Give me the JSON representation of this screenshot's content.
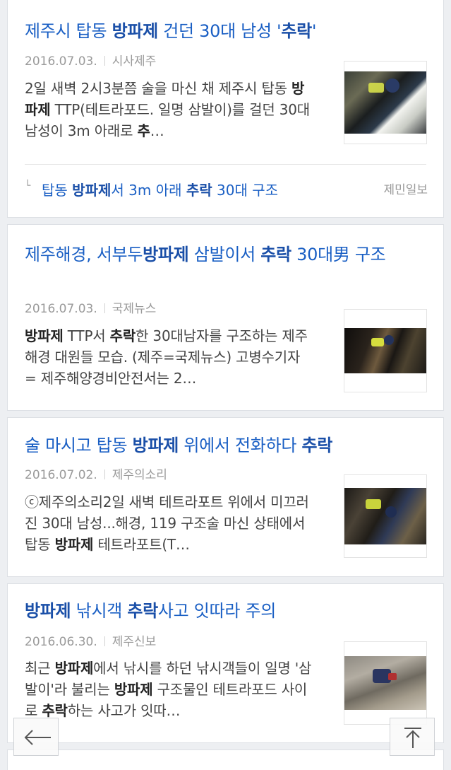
{
  "articles": [
    {
      "title": [
        {
          "t": "제주시 탑동 "
        },
        {
          "t": "방파제",
          "b": true
        },
        {
          "t": " 건던 30대 남성 '"
        },
        {
          "t": "추락",
          "b": true
        },
        {
          "t": "'"
        }
      ],
      "date": "2016.07.03.",
      "source": "시사제주",
      "desc": [
        {
          "t": "2일 새벽 2시3분쯤 술을 마신 채 제주시 탑동 "
        },
        {
          "t": "방파제",
          "b": true
        },
        {
          "t": " TTP(테트라포드. 일명 삼발이)를 걸던 30대 남성이 3m 아래로 "
        },
        {
          "t": "추",
          "b": true
        },
        {
          "t": "…"
        }
      ],
      "related": {
        "title": [
          {
            "t": "탑동 "
          },
          {
            "t": "방파제",
            "b": true
          },
          {
            "t": "서 3m 아래 "
          },
          {
            "t": "추락",
            "b": true
          },
          {
            "t": " 30대 구조"
          }
        ],
        "source": "제민일보"
      }
    },
    {
      "title": [
        {
          "t": "제주해경, 서부두"
        },
        {
          "t": "방파제",
          "b": true
        },
        {
          "t": " 삼발이서 "
        },
        {
          "t": "추락",
          "b": true
        },
        {
          "t": " 30대男 구조"
        }
      ],
      "date": "2016.07.03.",
      "source": "국제뉴스",
      "desc": [
        {
          "t": "방파제",
          "b": true
        },
        {
          "t": " TTP서 "
        },
        {
          "t": "추락",
          "b": true
        },
        {
          "t": "한 30대남자를 구조하는 제주해경 대원들 모습. (제주=국제뉴스) 고병수기자 = 제주해양경비안전서는 2…"
        }
      ]
    },
    {
      "title": [
        {
          "t": "술 마시고 탑동 "
        },
        {
          "t": "방파제",
          "b": true
        },
        {
          "t": " 위에서 전화하다 "
        },
        {
          "t": "추락",
          "b": true
        }
      ],
      "date": "2016.07.02.",
      "source": "제주의소리",
      "desc": [
        {
          "t": "ⓒ제주의소리2일 새벽 테트라포트 위에서 미끄러진 30대 남성...해경, 119 구조술 마신 상태에서 탑동 "
        },
        {
          "t": "방파제",
          "b": true
        },
        {
          "t": " 테트라포트(T…"
        }
      ]
    },
    {
      "title": [
        {
          "t": "방파제",
          "b": true
        },
        {
          "t": " 낚시객 "
        },
        {
          "t": "추락",
          "b": true
        },
        {
          "t": "사고 잇따라 주의"
        }
      ],
      "date": "2016.06.30.",
      "source": "제주신보",
      "desc": [
        {
          "t": "최근 "
        },
        {
          "t": "방파제",
          "b": true
        },
        {
          "t": "에서 낚시를 하던 낚시객들이 일명 '삼발이'라 불리는 "
        },
        {
          "t": "방파제",
          "b": true
        },
        {
          "t": " 구조물인 테트라포드 사이로 "
        },
        {
          "t": "추락",
          "b": true
        },
        {
          "t": "하는 사고가 잇따…"
        }
      ]
    }
  ],
  "nav": {
    "back_icon": "arrow-left-icon",
    "top_icon": "scroll-to-top-icon"
  },
  "colors": {
    "title": "#1a5fc4",
    "highlight": "#1a4fa8",
    "meta": "#9a9a9a",
    "background": "#edeff2"
  }
}
